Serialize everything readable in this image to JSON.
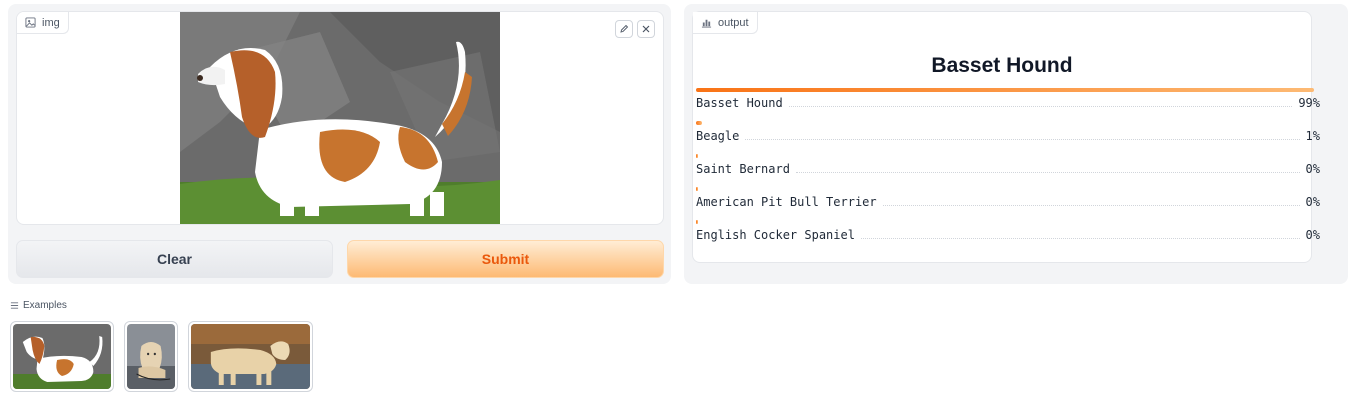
{
  "input": {
    "label": "img",
    "image_alt": "basset-hound-photo",
    "tools": [
      "edit-icon",
      "close-icon"
    ]
  },
  "buttons": {
    "clear": "Clear",
    "submit": "Submit"
  },
  "output": {
    "label": "output",
    "top_label": "Basset Hound",
    "confidences": [
      {
        "name": "Basset Hound",
        "pct": "99%",
        "value": 0.99
      },
      {
        "name": "Beagle",
        "pct": "1%",
        "value": 0.01
      },
      {
        "name": "Saint Bernard",
        "pct": "0%",
        "value": 0.0
      },
      {
        "name": "American Pit Bull Terrier",
        "pct": "0%",
        "value": 0.0
      },
      {
        "name": "English Cocker Spaniel",
        "pct": "0%",
        "value": 0.0
      }
    ]
  },
  "examples": {
    "label": "Examples",
    "items": [
      "basset-hound-example",
      "puppy-example",
      "golden-retriever-example"
    ]
  },
  "colors": {
    "accent": "#f97316",
    "submit_text": "#ea580c"
  }
}
